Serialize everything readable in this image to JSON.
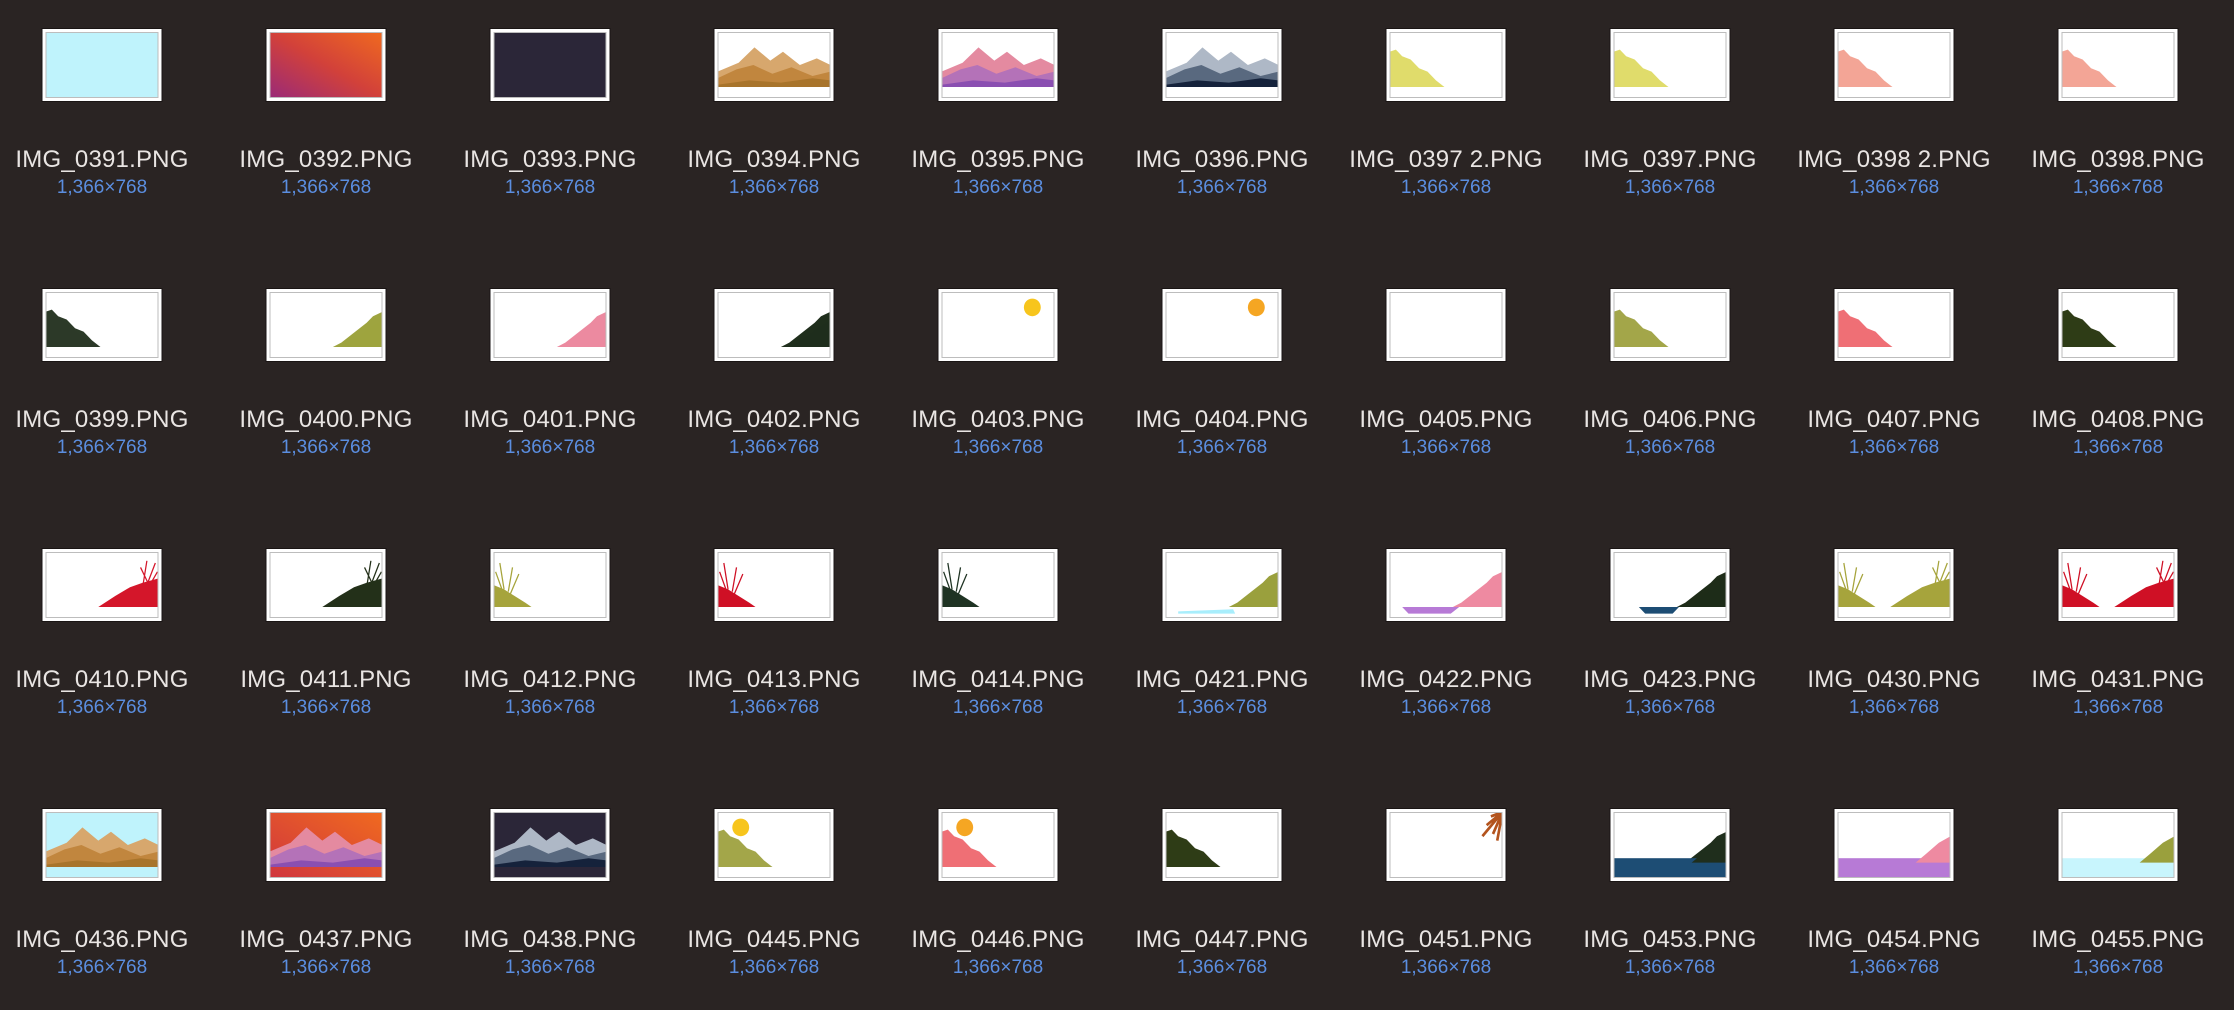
{
  "files": [
    {
      "name": "IMG_0391.PNG",
      "dims": "1,366×768",
      "thumb": "lightcyan"
    },
    {
      "name": "IMG_0392.PNG",
      "dims": "1,366×768",
      "thumb": "sunset-gradient"
    },
    {
      "name": "IMG_0393.PNG",
      "dims": "1,366×768",
      "thumb": "dark-navy"
    },
    {
      "name": "IMG_0394.PNG",
      "dims": "1,366×768",
      "thumb": "desert-mountains"
    },
    {
      "name": "IMG_0395.PNG",
      "dims": "1,366×768",
      "thumb": "purple-mountains"
    },
    {
      "name": "IMG_0396.PNG",
      "dims": "1,366×768",
      "thumb": "navy-mountains"
    },
    {
      "name": "IMG_0397 2.PNG",
      "dims": "1,366×768",
      "thumb": "yellow-hill-left"
    },
    {
      "name": "IMG_0397.PNG",
      "dims": "1,366×768",
      "thumb": "yellow-hill-left"
    },
    {
      "name": "IMG_0398 2.PNG",
      "dims": "1,366×768",
      "thumb": "pink-hill-left"
    },
    {
      "name": "IMG_0398.PNG",
      "dims": "1,366×768",
      "thumb": "pink-hill-left"
    },
    {
      "name": "IMG_0399.PNG",
      "dims": "1,366×768",
      "thumb": "dark-hill-left"
    },
    {
      "name": "IMG_0400.PNG",
      "dims": "1,366×768",
      "thumb": "olive-hill-right"
    },
    {
      "name": "IMG_0401.PNG",
      "dims": "1,366×768",
      "thumb": "pink-hill-right"
    },
    {
      "name": "IMG_0402.PNG",
      "dims": "1,366×768",
      "thumb": "dark-hill-right"
    },
    {
      "name": "IMG_0403.PNG",
      "dims": "1,366×768",
      "thumb": "yellow-sun"
    },
    {
      "name": "IMG_0404.PNG",
      "dims": "1,366×768",
      "thumb": "orange-sun"
    },
    {
      "name": "IMG_0405.PNG",
      "dims": "1,366×768",
      "thumb": "blank"
    },
    {
      "name": "IMG_0406.PNG",
      "dims": "1,366×768",
      "thumb": "olive-hill-left"
    },
    {
      "name": "IMG_0407.PNG",
      "dims": "1,366×768",
      "thumb": "coral-hill-left"
    },
    {
      "name": "IMG_0408.PNG",
      "dims": "1,366×768",
      "thumb": "darkgreen-hill-left"
    },
    {
      "name": "IMG_0410.PNG",
      "dims": "1,366×768",
      "thumb": "red-grass-right"
    },
    {
      "name": "IMG_0411.PNG",
      "dims": "1,366×768",
      "thumb": "dark-grass-right"
    },
    {
      "name": "IMG_0412.PNG",
      "dims": "1,366×768",
      "thumb": "olive-grass-left"
    },
    {
      "name": "IMG_0413.PNG",
      "dims": "1,366×768",
      "thumb": "red-grass-left"
    },
    {
      "name": "IMG_0414.PNG",
      "dims": "1,366×768",
      "thumb": "dark-grass-left"
    },
    {
      "name": "IMG_0421.PNG",
      "dims": "1,366×768",
      "thumb": "olive-lake-right"
    },
    {
      "name": "IMG_0422.PNG",
      "dims": "1,366×768",
      "thumb": "pink-lake-right"
    },
    {
      "name": "IMG_0423.PNG",
      "dims": "1,366×768",
      "thumb": "dark-lake-right"
    },
    {
      "name": "IMG_0430.PNG",
      "dims": "1,366×768",
      "thumb": "olive-grass-both"
    },
    {
      "name": "IMG_0431.PNG",
      "dims": "1,366×768",
      "thumb": "red-grass-both"
    },
    {
      "name": "IMG_0436.PNG",
      "dims": "1,366×768",
      "thumb": "desert-scene"
    },
    {
      "name": "IMG_0437.PNG",
      "dims": "1,366×768",
      "thumb": "sunset-scene"
    },
    {
      "name": "IMG_0438.PNG",
      "dims": "1,366×768",
      "thumb": "night-scene"
    },
    {
      "name": "IMG_0445.PNG",
      "dims": "1,366×768",
      "thumb": "yellow-sun-hill"
    },
    {
      "name": "IMG_0446.PNG",
      "dims": "1,366×768",
      "thumb": "orange-sun-hill"
    },
    {
      "name": "IMG_0447.PNG",
      "dims": "1,366×768",
      "thumb": "darkgreen-hill-left"
    },
    {
      "name": "IMG_0451.PNG",
      "dims": "1,366×768",
      "thumb": "palm-corner"
    },
    {
      "name": "IMG_0453.PNG",
      "dims": "1,366×768",
      "thumb": "blue-water-hill"
    },
    {
      "name": "IMG_0454.PNG",
      "dims": "1,366×768",
      "thumb": "purple-water-hill"
    },
    {
      "name": "IMG_0455.PNG",
      "dims": "1,366×768",
      "thumb": "cyan-water-hill"
    }
  ]
}
